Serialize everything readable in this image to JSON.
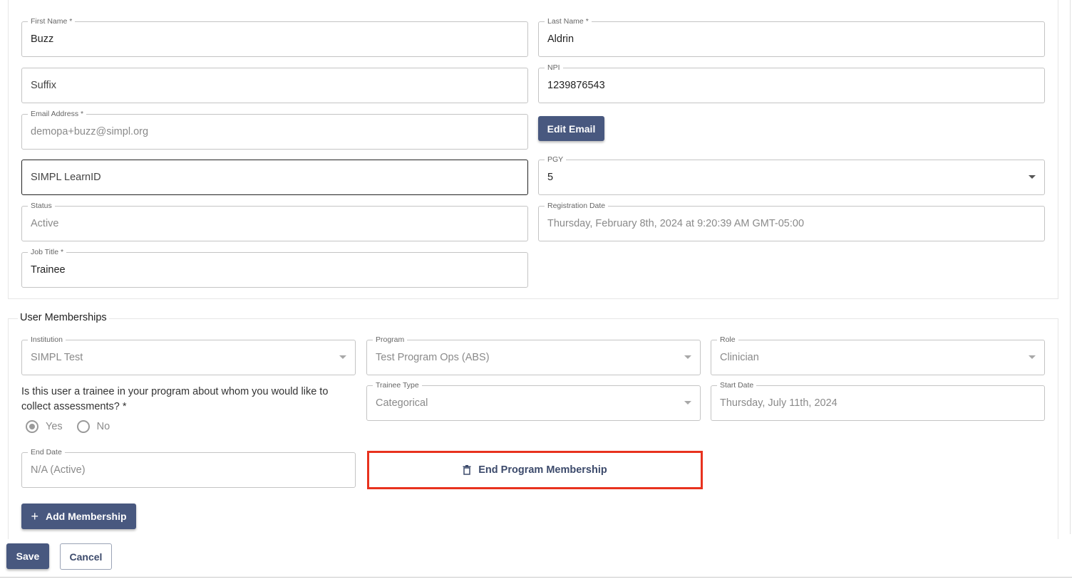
{
  "profile": {
    "first_name": {
      "label": "First Name *",
      "value": "Buzz"
    },
    "last_name": {
      "label": "Last Name *",
      "value": "Aldrin"
    },
    "suffix": {
      "placeholder": "Suffix"
    },
    "npi": {
      "label": "NPI",
      "value": "1239876543"
    },
    "email": {
      "label": "Email Address *",
      "value": "demopa+buzz@simpl.org"
    },
    "edit_email_label": "Edit Email",
    "learn_id": {
      "placeholder": "SIMPL LearnID"
    },
    "pgy": {
      "label": "PGY",
      "value": "5"
    },
    "status": {
      "label": "Status",
      "value": "Active"
    },
    "registration_date": {
      "label": "Registration Date",
      "value": "Thursday, February 8th, 2024 at 9:20:39 AM GMT-05:00"
    },
    "job_title": {
      "label": "Job Title *",
      "value": "Trainee"
    }
  },
  "memberships": {
    "title": "User Memberships",
    "institution": {
      "label": "Institution",
      "value": "SIMPL Test"
    },
    "program": {
      "label": "Program",
      "value": "Test Program Ops (ABS)"
    },
    "role": {
      "label": "Role",
      "value": "Clinician"
    },
    "question": "Is this user a trainee in your program about whom you would like to collect assessments? *",
    "radio_yes": "Yes",
    "radio_no": "No",
    "trainee_type": {
      "label": "Trainee Type",
      "value": "Categorical"
    },
    "start_date": {
      "label": "Start Date",
      "value": "Thursday, July 11th, 2024"
    },
    "end_date": {
      "label": "End Date",
      "value": "N/A (Active)"
    },
    "end_membership_label": "End Program Membership",
    "add_membership_label": "Add Membership"
  },
  "footer": {
    "save_label": "Save",
    "cancel_label": "Cancel"
  },
  "colors": {
    "primary": "#48587f",
    "highlight": "#e8321e"
  }
}
